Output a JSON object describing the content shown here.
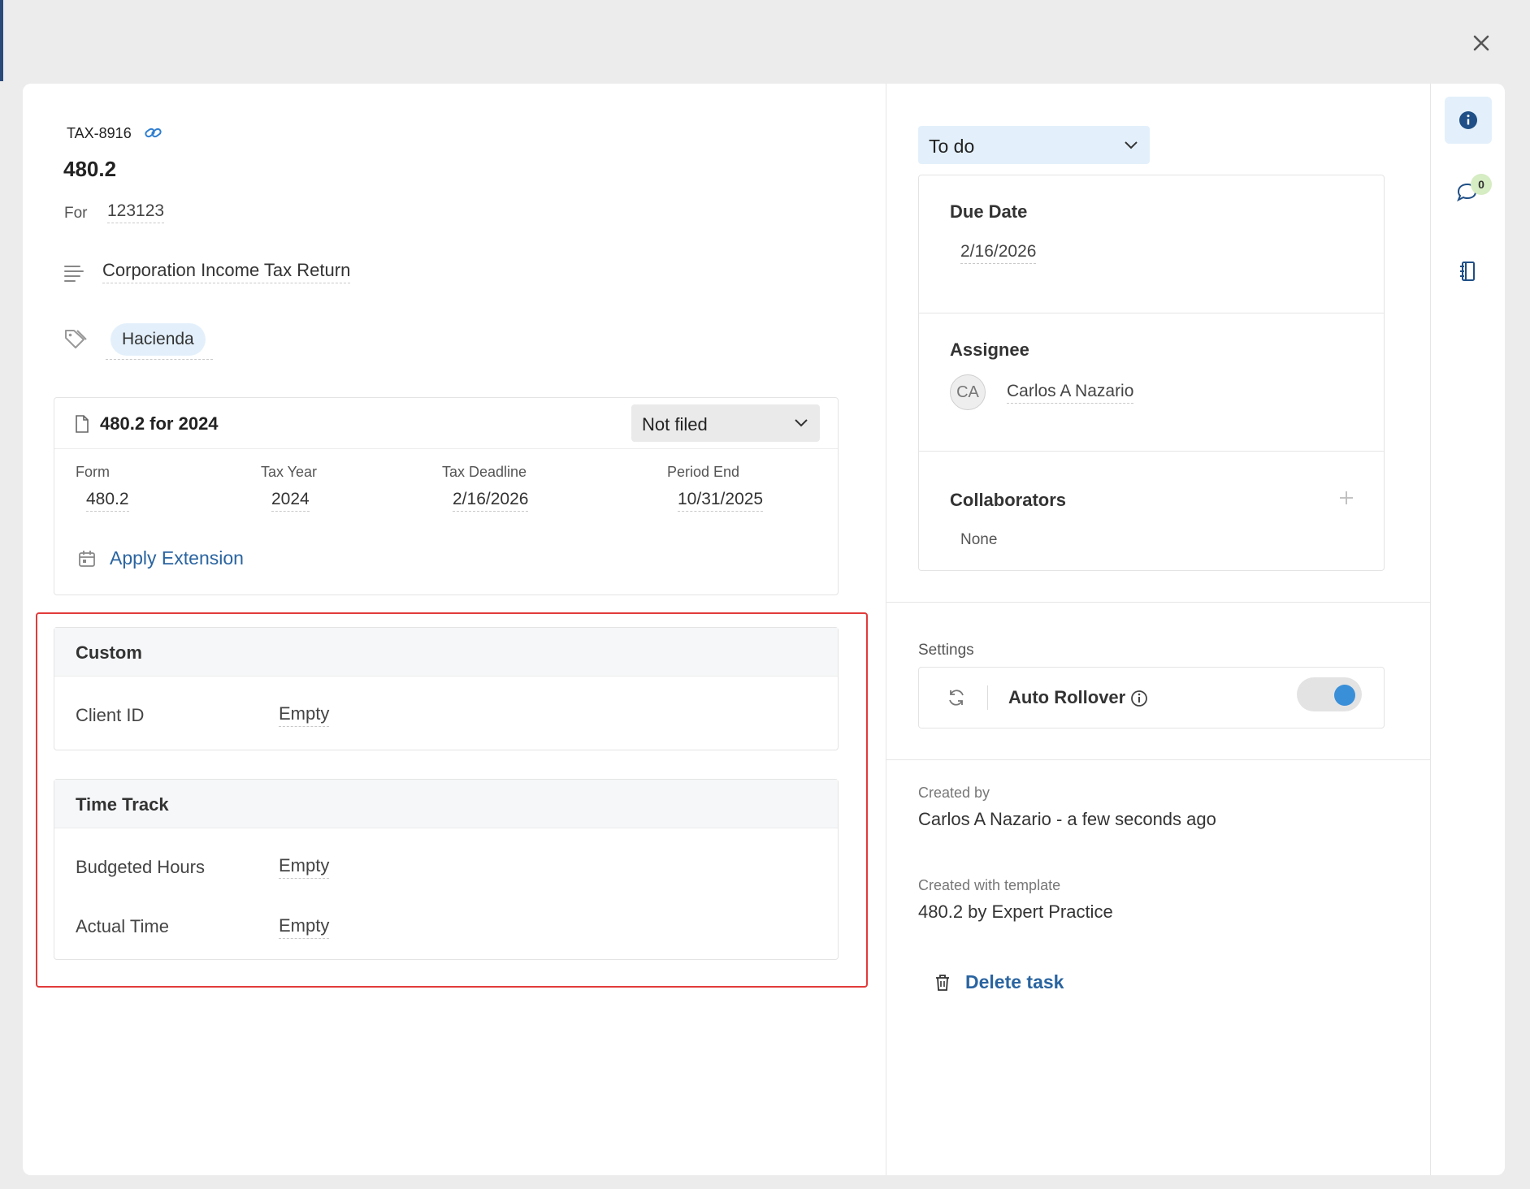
{
  "task": {
    "key": "TAX-8916",
    "title": "480.2",
    "for_label": "For",
    "for_value": "123123",
    "description": "Corporation Income Tax Return",
    "tag": "Hacienda"
  },
  "filing": {
    "title": "480.2 for 2024",
    "status": "Not filed",
    "columns": [
      {
        "label": "Form",
        "value": "480.2"
      },
      {
        "label": "Tax Year",
        "value": "2024"
      },
      {
        "label": "Tax Deadline",
        "value": "2/16/2026"
      },
      {
        "label": "Period End",
        "value": "10/31/2025"
      }
    ],
    "apply_extension": "Apply Extension"
  },
  "custom": {
    "title": "Custom",
    "fields": [
      {
        "label": "Client ID",
        "value": "Empty"
      }
    ]
  },
  "time_track": {
    "title": "Time Track",
    "fields": [
      {
        "label": "Budgeted Hours",
        "value": "Empty"
      },
      {
        "label": "Actual Time",
        "value": "Empty"
      }
    ]
  },
  "status_select": {
    "value": "To do"
  },
  "due_date": {
    "title": "Due Date",
    "value": "2/16/2026"
  },
  "assignee": {
    "title": "Assignee",
    "initials": "CA",
    "name": "Carlos A Nazario"
  },
  "collaborators": {
    "title": "Collaborators",
    "value": "None"
  },
  "settings": {
    "label": "Settings",
    "auto_rollover": "Auto Rollover",
    "auto_rollover_on": true
  },
  "meta": {
    "created_by_label": "Created by",
    "created_by_value": "Carlos A Nazario - a few seconds ago",
    "template_label": "Created with template",
    "template_value": "480.2 by Expert Practice"
  },
  "delete_label": "Delete task",
  "side": {
    "comment_count": "0"
  },
  "icons": [
    "close-icon",
    "link-icon",
    "description-icon",
    "tag-icon",
    "file-icon",
    "chevron-down-icon",
    "calendar-icon",
    "plus-icon",
    "refresh-icon",
    "info-icon",
    "trash-icon",
    "comment-icon",
    "panel-icon"
  ],
  "colors": {
    "accent": "#2a64a0",
    "highlight": "#e23b3b",
    "select_bg": "#e3f0fb",
    "toggle_knob": "#3a8fd9"
  }
}
